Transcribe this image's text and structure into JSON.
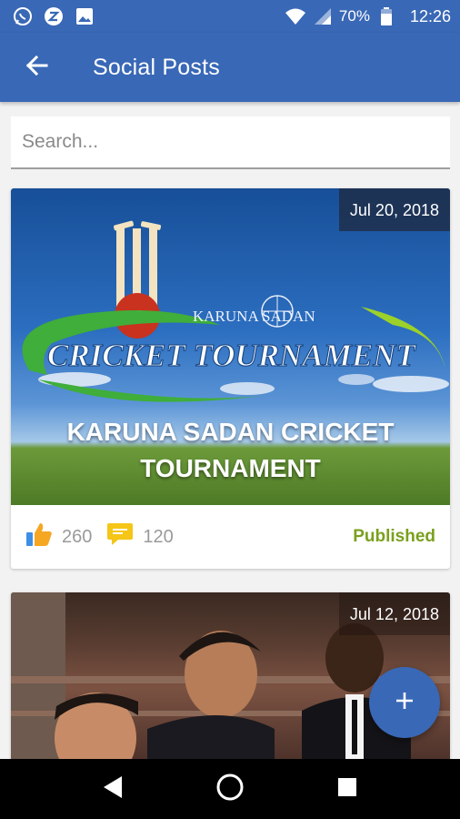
{
  "status_bar": {
    "battery": "70%",
    "time": "12:26",
    "icons": [
      "whatsapp-icon",
      "zap-icon",
      "gallery-icon",
      "wifi-icon",
      "signal-icon",
      "battery-icon"
    ]
  },
  "app_bar": {
    "title": "Social Posts",
    "back_icon": "arrow-left-icon"
  },
  "search": {
    "placeholder": "Search..."
  },
  "posts": [
    {
      "date": "Jul 20, 2018",
      "image_logo_text": "KARUNA SADAN",
      "image_banner_text": "CRICKET TOURNAMENT",
      "caption_line1": "KARUNA SADAN CRICKET",
      "caption_line2": "TOURNAMENT",
      "likes": "260",
      "comments": "120",
      "status": "Published"
    },
    {
      "date": "Jul 12, 2018"
    }
  ],
  "colors": {
    "primary": "#3968b6",
    "published": "#7aa01d",
    "like_icon": "#f5a623",
    "comment_icon": "#f5c518"
  },
  "fab": {
    "icon": "plus-icon"
  },
  "nav": {
    "icons": [
      "back-triangle-icon",
      "home-circle-icon",
      "recents-square-icon"
    ]
  }
}
